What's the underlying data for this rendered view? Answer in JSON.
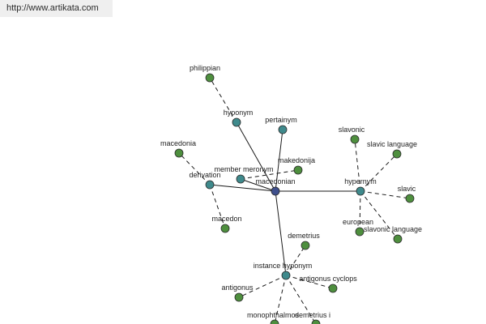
{
  "header": {
    "url": "http://www.artikata.com"
  },
  "colors": {
    "center": "#3f4f8c",
    "relation": "#3f8a8c",
    "leaf": "#4e8f3e",
    "edge": "#1a1a1a"
  },
  "graph": {
    "center": {
      "id": "macedonian",
      "label": "macedonian"
    },
    "relations": [
      {
        "id": "hyponym",
        "label": "hyponym"
      },
      {
        "id": "pertainym",
        "label": "pertainym"
      },
      {
        "id": "member-meronym",
        "label": "member meronym"
      },
      {
        "id": "derivation",
        "label": "derivation"
      },
      {
        "id": "hypernym",
        "label": "hypernym"
      },
      {
        "id": "instance-hyponym",
        "label": "instance hyponym"
      }
    ],
    "leaves": [
      {
        "id": "philippian",
        "label": "philippian",
        "parent": "hyponym"
      },
      {
        "id": "makedonija",
        "label": "makedonija",
        "parent": "member-meronym"
      },
      {
        "id": "macedonia",
        "label": "macedonia",
        "parent": "derivation"
      },
      {
        "id": "macedon",
        "label": "macedon",
        "parent": "derivation"
      },
      {
        "id": "slavonic",
        "label": "slavonic",
        "parent": "hypernym"
      },
      {
        "id": "slavic-language",
        "label": "slavic language",
        "parent": "hypernym"
      },
      {
        "id": "slavic",
        "label": "slavic",
        "parent": "hypernym"
      },
      {
        "id": "european",
        "label": "european",
        "parent": "hypernym"
      },
      {
        "id": "slavonic-language",
        "label": "slavonic language",
        "parent": "hypernym"
      },
      {
        "id": "demetrius",
        "label": "demetrius",
        "parent": "instance-hyponym"
      },
      {
        "id": "antigonus-cyclops",
        "label": "antigonus cyclops",
        "parent": "instance-hyponym"
      },
      {
        "id": "antigonus",
        "label": "antigonus",
        "parent": "instance-hyponym"
      },
      {
        "id": "monophthalmos",
        "label": "monophthalmos",
        "parent": "instance-hyponym"
      },
      {
        "id": "demetrius-i",
        "label": "demetrius i",
        "parent": "instance-hyponym"
      }
    ]
  }
}
